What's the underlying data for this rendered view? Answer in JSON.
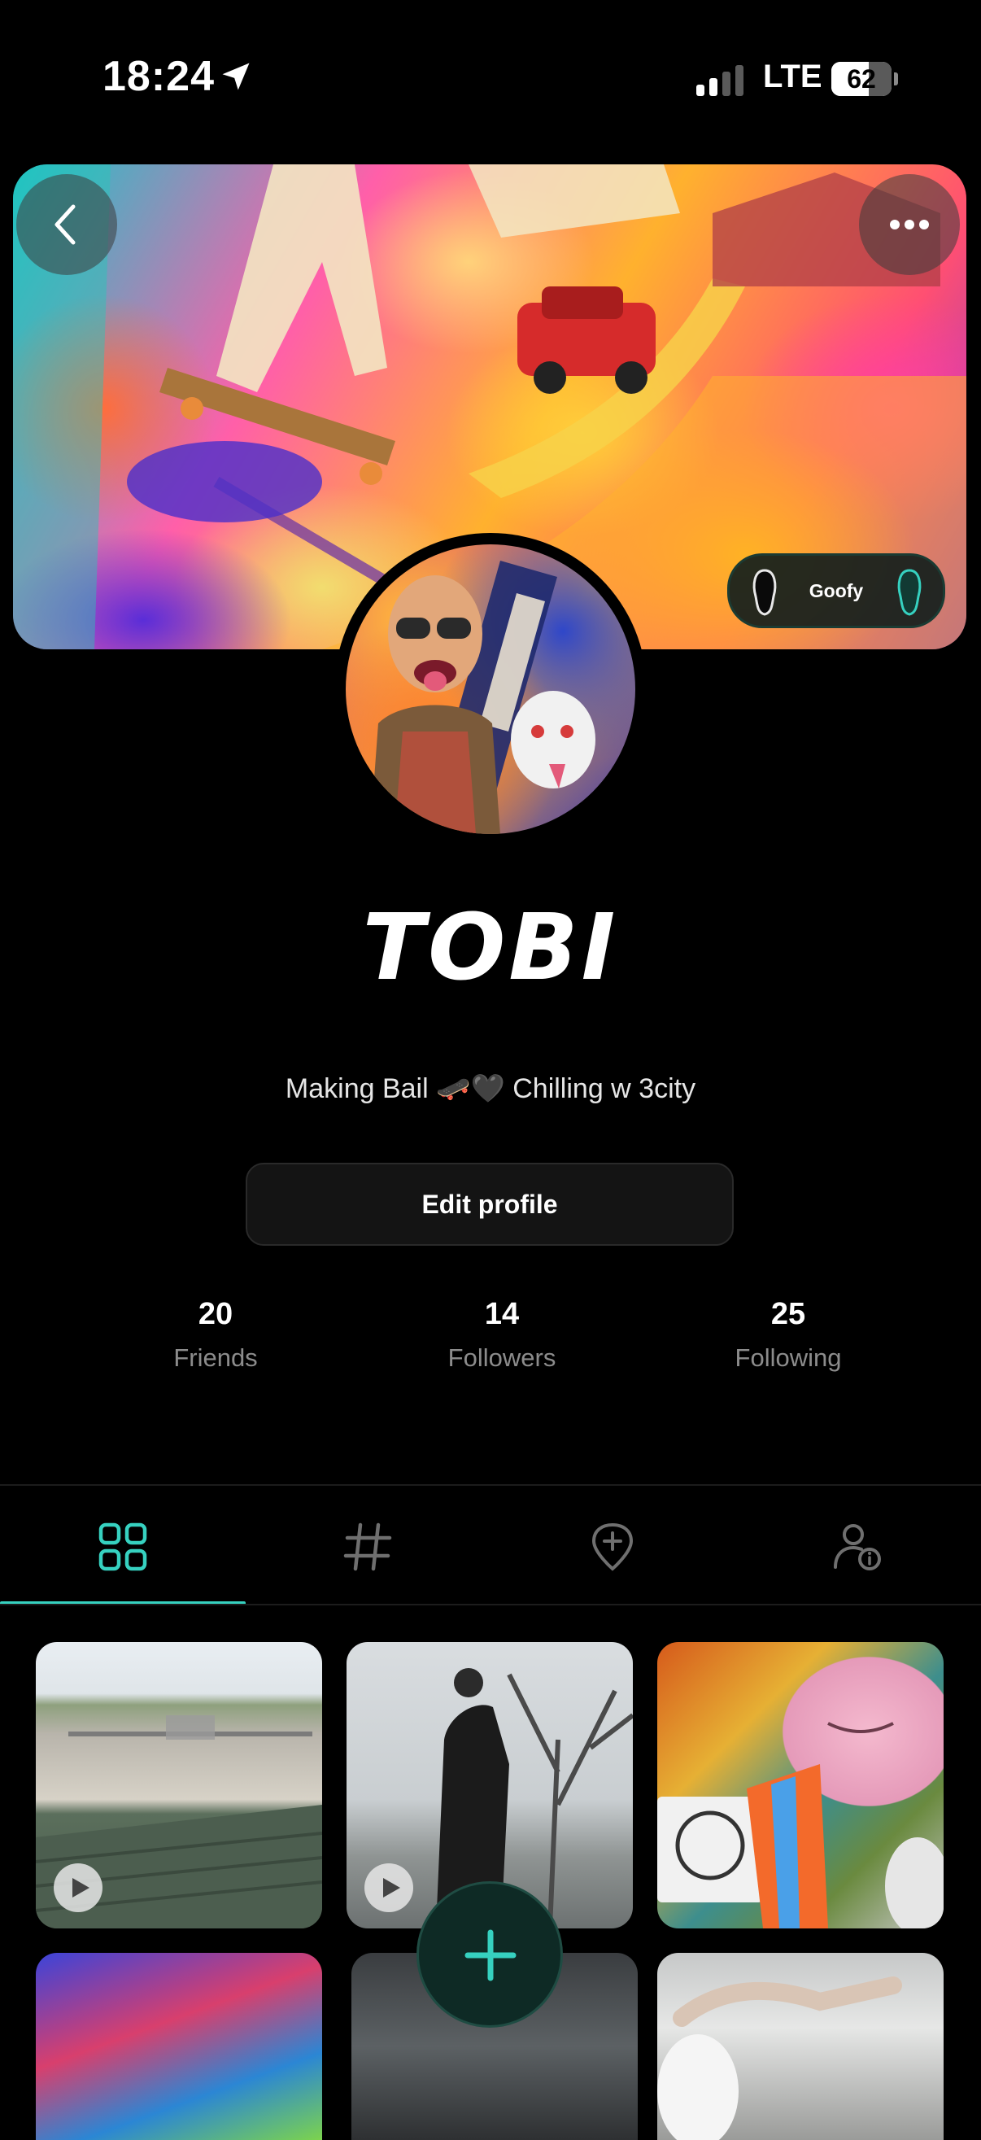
{
  "status_bar": {
    "time": "18:24",
    "network": "LTE",
    "battery_level": "62",
    "battery_fraction": 0.62
  },
  "cover": {
    "back_icon": "chevron-left-icon",
    "more_icon": "more-horizontal-icon",
    "stance_label": "Goofy"
  },
  "profile": {
    "display_name": "TOBI",
    "bio": "Making Bail 🛹🖤 Chilling w 3city",
    "edit_button_label": "Edit profile"
  },
  "stats": [
    {
      "value": "20",
      "label": "Friends"
    },
    {
      "value": "14",
      "label": "Followers"
    },
    {
      "value": "25",
      "label": "Following"
    }
  ],
  "tabs": [
    {
      "icon": "grid-icon",
      "active": true
    },
    {
      "icon": "hashtag-icon",
      "active": false
    },
    {
      "icon": "map-pin-plus-icon",
      "active": false
    },
    {
      "icon": "user-info-icon",
      "active": false
    }
  ],
  "posts": [
    {
      "type": "video"
    },
    {
      "type": "video"
    },
    {
      "type": "image"
    },
    {
      "type": "image"
    },
    {
      "type": "image"
    },
    {
      "type": "image"
    }
  ],
  "colors": {
    "accent": "#36d1c0",
    "background": "#000000",
    "muted_text": "#8c8c8c"
  }
}
